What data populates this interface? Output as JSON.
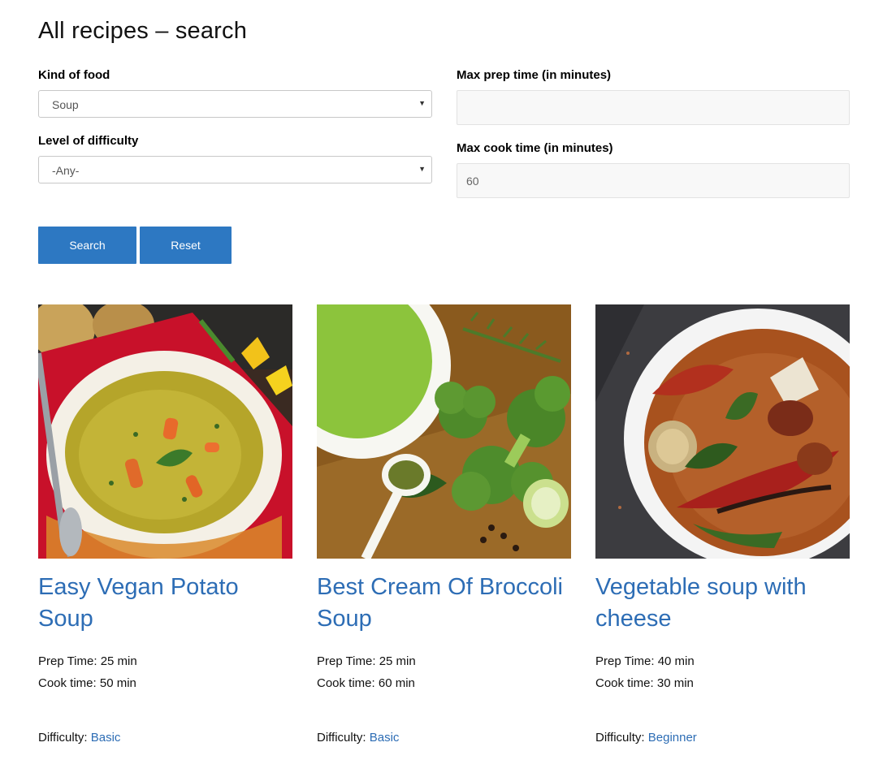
{
  "page_title": "All recipes – search",
  "filters": {
    "kind_label": "Kind of food",
    "kind_value": "Soup",
    "difficulty_label": "Level of difficulty",
    "difficulty_value": "-Any-",
    "prep_label": "Max prep time (in minutes)",
    "prep_value": "",
    "cook_label": "Max cook time (in minutes)",
    "cook_value": "60"
  },
  "buttons": {
    "search": "Search",
    "reset": "Reset"
  },
  "recipes": [
    {
      "title": "Easy Vegan Potato Soup",
      "prep": "Prep Time: 25 min",
      "cook": "Cook time: 50 min",
      "difficulty_label": "Difficulty:",
      "difficulty": "Basic"
    },
    {
      "title": "Best Cream Of Broccoli Soup",
      "prep": "Prep Time: 25 min",
      "cook": "Cook time: 60 min",
      "difficulty_label": "Difficulty:",
      "difficulty": "Basic"
    },
    {
      "title": "Vegetable soup with cheese",
      "prep": "Prep Time: 40 min",
      "cook": "Cook time: 30 min",
      "difficulty_label": "Difficulty:",
      "difficulty": "Beginner"
    }
  ],
  "colors": {
    "accent": "#2d78c2",
    "link": "#2d6db5"
  }
}
